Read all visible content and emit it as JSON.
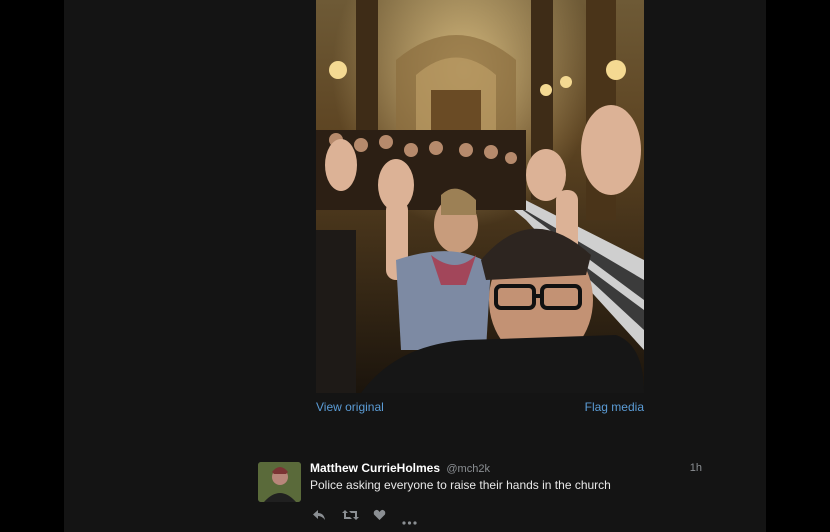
{
  "media": {
    "view_original": "View original",
    "flag_media": "Flag media"
  },
  "tweet": {
    "name": "Matthew CurrieHolmes",
    "handle": "@mch2k",
    "time": "1h",
    "text": "Police asking everyone to raise their hands in the church"
  },
  "actions": {
    "reply_icon": "reply-icon",
    "retweet_icon": "retweet-icon",
    "like_icon": "heart-icon",
    "more_icon": "more-icon"
  },
  "colors": {
    "link": "#5b9cd6",
    "muted": "#8b8f93",
    "background": "#141414"
  }
}
